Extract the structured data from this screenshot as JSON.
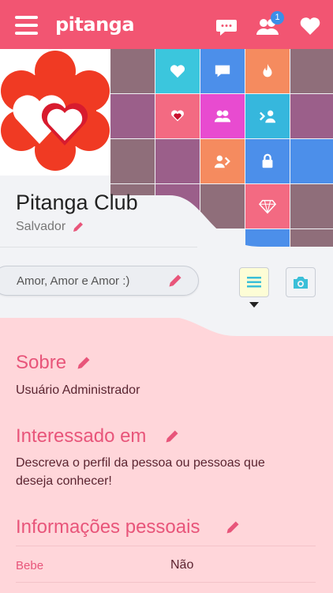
{
  "app": {
    "logo": "pitanga",
    "notification_count": "1"
  },
  "profile": {
    "name": "Pitanga Club",
    "city": "Salvador",
    "status": "Amor, Amor e Amor :)"
  },
  "sections": {
    "about": {
      "title": "Sobre",
      "text": "Usuário Administrador"
    },
    "interest": {
      "title": "Interessado em",
      "text": "Descreva o perfil da pessoa ou pessoas que deseja conhecer!"
    },
    "personal": {
      "title": "Informações pessoais",
      "rows": [
        {
          "label": "Bebe",
          "value": "Não"
        }
      ]
    }
  },
  "colors": {
    "accent": "#f25572",
    "title": "#e8557a",
    "section_bg": "#ffd6da"
  },
  "icons": [
    "menu-icon",
    "chat-icon",
    "friends-icon",
    "heart-icon",
    "pencil-icon",
    "camera-icon",
    "list-icon",
    "fire-icon",
    "lock-icon",
    "diamond-icon"
  ]
}
